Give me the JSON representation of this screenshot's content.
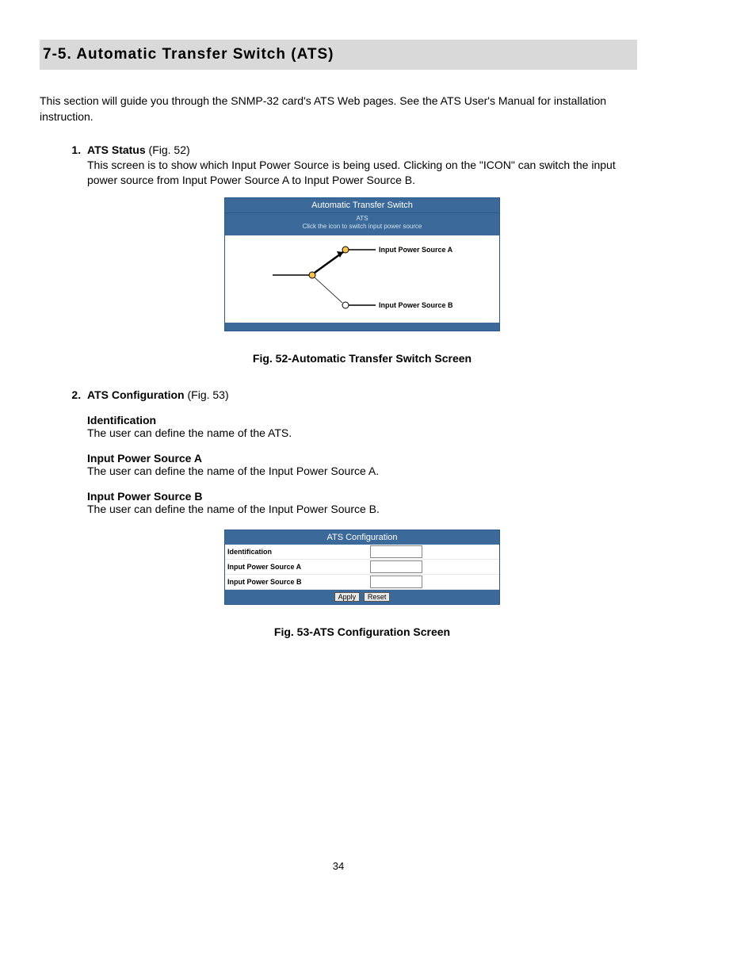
{
  "heading": "7-5.  Automatic Transfer Switch (ATS)",
  "intro": "This section will guide you through the SNMP-32 card's ATS Web pages.  See the ATS User's Manual for installation instruction.",
  "item1": {
    "num": "1.",
    "title": "ATS Status",
    "ref": " (Fig. 52)",
    "body": "This screen is to show which Input Power Source is being used.  Clicking on the \"ICON\" can switch the input power source from Input Power Source A to Input Power Source B."
  },
  "fig52": {
    "title": "Automatic Transfer Switch",
    "sub_line1": "ATS",
    "sub_line2": "Click the icon to switch input power source",
    "label_a": "Input Power Source A",
    "label_b": "Input Power Source B",
    "caption": "Fig. 52-Automatic Transfer Switch Screen"
  },
  "item2": {
    "num": "2.",
    "title": "ATS Configuration",
    "ref": " (Fig. 53)",
    "sections": [
      {
        "h": "Identification",
        "t": "The user can define the name of the ATS."
      },
      {
        "h": "Input Power Source A",
        "t": "The user can define the name of the Input Power Source A."
      },
      {
        "h": "Input Power Source B",
        "t": "The user can define the name of the Input Power Source B."
      }
    ]
  },
  "fig53": {
    "title": "ATS Configuration",
    "row1": "Identification",
    "row2": "Input Power Source A",
    "row3": "Input Power Source B",
    "btn_apply": "Apply",
    "btn_reset": "Reset",
    "caption": "Fig. 53-ATS Configuration Screen"
  },
  "page_number": "34"
}
